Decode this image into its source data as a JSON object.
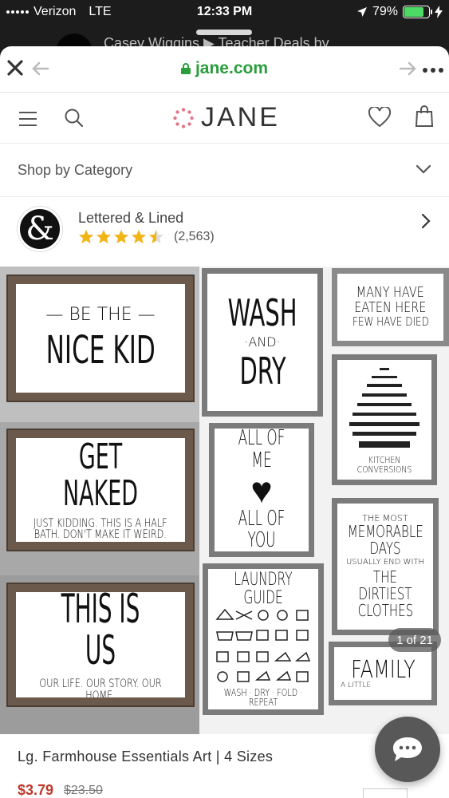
{
  "status_bar": {
    "carrier": "Verizon",
    "network": "LTE",
    "time": "12:33 PM",
    "battery": "79%",
    "battery_level": 0.79
  },
  "peek": {
    "text": "Casey Wiggins ▶ Teacher Deals by"
  },
  "browser": {
    "domain": "jane.com"
  },
  "nav": {
    "logo_text": "JANE"
  },
  "category": {
    "label": "Shop by Category"
  },
  "seller": {
    "logo_glyph": "&",
    "name": "Lettered & Lined",
    "rating": 4.5,
    "rating_max": 5,
    "reviews": "(2,563)"
  },
  "signs": {
    "nice_kid": {
      "top": "— BE THE —",
      "main": "NICE KID"
    },
    "wash": {
      "l1": "WASH",
      "l2": "·AND·",
      "l3": "DRY"
    },
    "many": {
      "l1": "MANY HAVE",
      "l2": "EATEN HERE",
      "l3": "FEW HAVE DIED"
    },
    "kitchen": {
      "footer": "KITCHEN CONVERSIONS"
    },
    "naked": {
      "main": "GET NAKED",
      "sub1": "JUST KIDDING. THIS IS A HALF",
      "sub2": "BATH. DON'T MAKE IT WEIRD."
    },
    "allofme": {
      "l1": "ALL OF ME",
      "heart": "♥",
      "l2": "ALL OF YOU"
    },
    "memorable": {
      "l1": "THE MOST",
      "l2": "MEMORABLE",
      "l3": "DAYS",
      "l4": "USUALLY END WITH",
      "l5": "THE DIRTIEST",
      "l6": "CLOTHES"
    },
    "thisisus": {
      "main": "THIS IS US",
      "sub": "OUR LIFE. OUR STORY. OUR HOME."
    },
    "laundry": {
      "title": "LAUNDRY GUIDE",
      "footer": "WASH · DRY · FOLD · REPEAT"
    },
    "family": {
      "main": "FAMILY",
      "sub": "A LITTLE"
    }
  },
  "gallery": {
    "counter": "1 of 21"
  },
  "product": {
    "title": "Lg. Farmhouse Essentials Art | 4 Sizes",
    "price": "$3.79",
    "original_price": "$23.50"
  },
  "colors": {
    "accent_green": "#2a9d3c",
    "price_red": "#c0392b",
    "star": "#f1b516"
  }
}
